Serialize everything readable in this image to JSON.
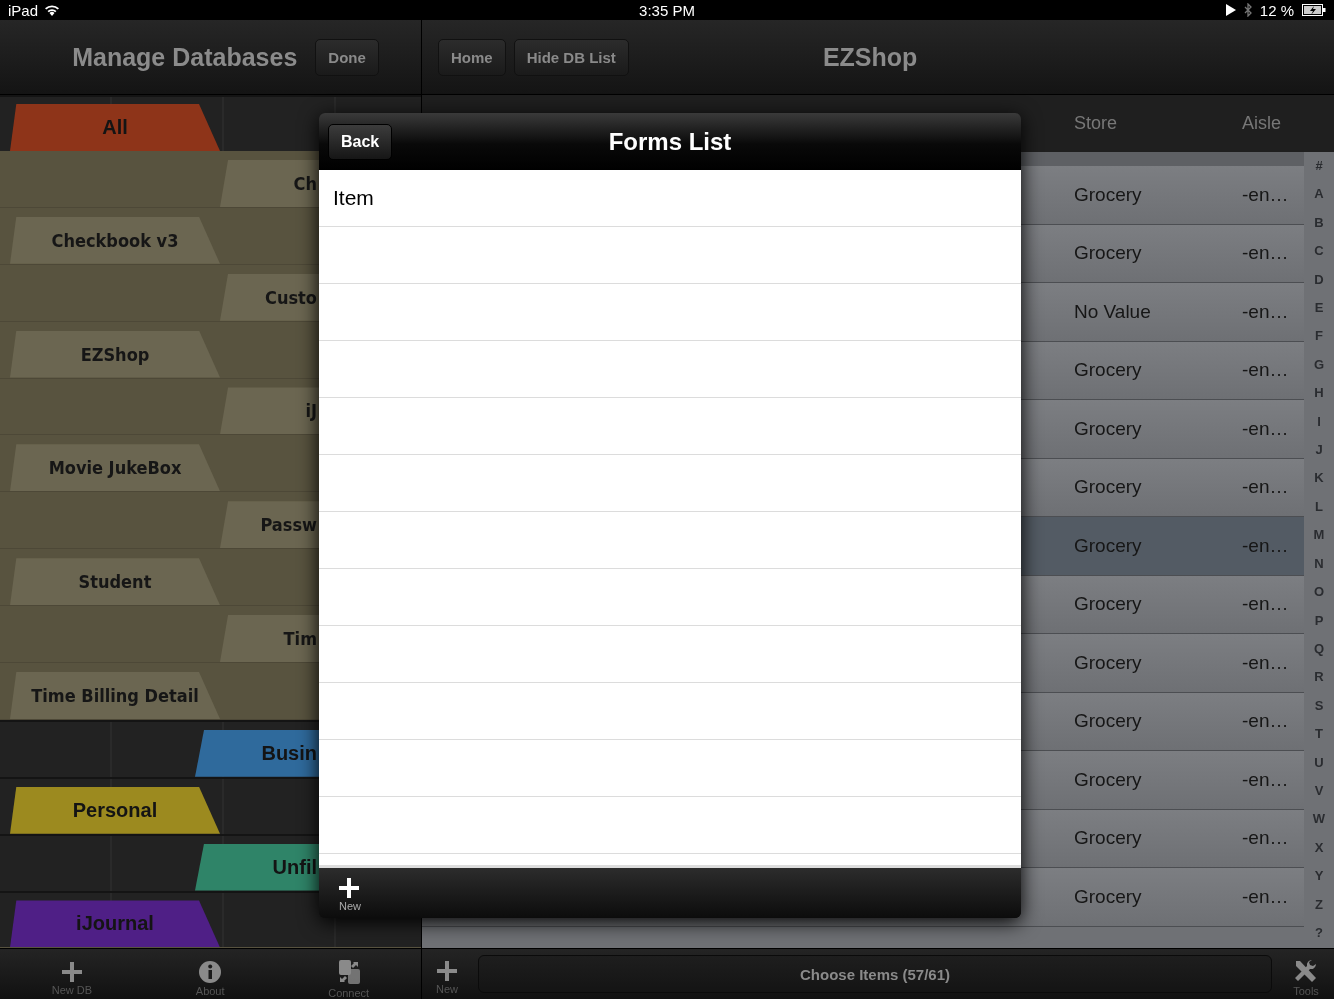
{
  "status_bar": {
    "carrier": "iPad",
    "time": "3:35 PM",
    "battery": "12 %"
  },
  "db_panel": {
    "title": "Manage Databases",
    "done_button": "Done",
    "tabs": [
      {
        "label": "All",
        "kind": "category",
        "color": "#8e3419"
      },
      {
        "label": "Ch",
        "kind": "database"
      },
      {
        "label": "Checkbook v3",
        "kind": "database"
      },
      {
        "label": "Custo",
        "kind": "database"
      },
      {
        "label": "EZShop",
        "kind": "database"
      },
      {
        "label": "iJ",
        "kind": "database"
      },
      {
        "label": "Movie JukeBox",
        "kind": "database"
      },
      {
        "label": "Passw",
        "kind": "database"
      },
      {
        "label": "Student",
        "kind": "database"
      },
      {
        "label": "Tim",
        "kind": "database"
      },
      {
        "label": "Time Billing Detail",
        "kind": "database"
      },
      {
        "label": "Busin",
        "kind": "category",
        "color": "#2f6a9c"
      },
      {
        "label": "Personal",
        "kind": "category",
        "color": "#9c8a1f"
      },
      {
        "label": "Unfil",
        "kind": "category",
        "color": "#2f8468"
      },
      {
        "label": "iJournal",
        "kind": "category",
        "color": "#4f1f86"
      }
    ],
    "toolbar": [
      {
        "label": "New DB"
      },
      {
        "label": "About"
      },
      {
        "label": "Connect"
      }
    ]
  },
  "main": {
    "title": "EZShop",
    "buttons": [
      "Home",
      "Hide DB List"
    ],
    "columns": [
      "Store",
      "Aisle"
    ],
    "rows": [
      {
        "store": "Grocery",
        "aisle": "-en…",
        "selected": false
      },
      {
        "store": "Grocery",
        "aisle": "-en…",
        "selected": false
      },
      {
        "store": "No Value",
        "aisle": "-en…",
        "selected": false
      },
      {
        "store": "Grocery",
        "aisle": "-en…",
        "selected": false
      },
      {
        "store": "Grocery",
        "aisle": "-en…",
        "selected": false
      },
      {
        "store": "Grocery",
        "aisle": "-en…",
        "selected": false
      },
      {
        "store": "Grocery",
        "aisle": "-en…",
        "selected": true
      },
      {
        "store": "Grocery",
        "aisle": "-en…",
        "selected": false
      },
      {
        "store": "Grocery",
        "aisle": "-en…",
        "selected": false
      },
      {
        "store": "Grocery",
        "aisle": "-en…",
        "selected": false
      },
      {
        "store": "Grocery",
        "aisle": "-en…",
        "selected": false
      },
      {
        "store": "Grocery",
        "aisle": "-en…",
        "selected": false
      },
      {
        "store": "Grocery",
        "aisle": "-en…",
        "selected": false
      }
    ],
    "index": [
      "#",
      "A",
      "B",
      "C",
      "D",
      "E",
      "F",
      "G",
      "H",
      "I",
      "J",
      "K",
      "L",
      "M",
      "N",
      "O",
      "P",
      "Q",
      "R",
      "S",
      "T",
      "U",
      "V",
      "W",
      "X",
      "Y",
      "Z",
      "?"
    ],
    "toolbar": {
      "new_label": "New",
      "choose_button": "Choose Items (57/61)",
      "tools_label": "Tools"
    }
  },
  "popover": {
    "title": "Forms List",
    "back_button": "Back",
    "items": [
      "Item"
    ],
    "new_label": "New"
  }
}
